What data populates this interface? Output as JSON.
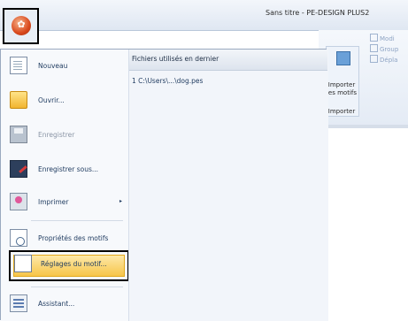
{
  "window": {
    "title": "Sans titre - PE-DESIGN PLUS2"
  },
  "ribbon": {
    "import_button_label_1": "Importer",
    "import_button_label_2": "les motifs",
    "import_group_label": "Importer",
    "mini_commands": [
      "Modi",
      "Group",
      "Dépla"
    ]
  },
  "file_menu": {
    "items": [
      {
        "label": "Nouveau",
        "icon": "new-document-icon",
        "enabled": true
      },
      {
        "label": "Ouvrir...",
        "icon": "open-folder-icon",
        "enabled": true
      },
      {
        "label": "Enregistrer",
        "icon": "save-icon",
        "enabled": false
      },
      {
        "label": "Enregistrer sous...",
        "icon": "save-as-icon",
        "enabled": true
      },
      {
        "label": "Imprimer",
        "icon": "print-icon",
        "enabled": true,
        "has_submenu": true
      },
      {
        "label": "Propriétés des motifs",
        "icon": "properties-icon",
        "enabled": true
      },
      {
        "label": "Réglages du motif...",
        "icon": "design-settings-icon",
        "enabled": true,
        "selected": true
      },
      {
        "label": "Assistant...",
        "icon": "wizard-icon",
        "enabled": true
      }
    ],
    "submenu_arrow": "▸",
    "recent": {
      "title": "Fichiers utilisés en dernier",
      "items": [
        "1 C:\\Users\\...\\dog.pes"
      ]
    }
  },
  "colors": {
    "highlight": "#f7c64a",
    "accent": "#1e3a5f"
  }
}
